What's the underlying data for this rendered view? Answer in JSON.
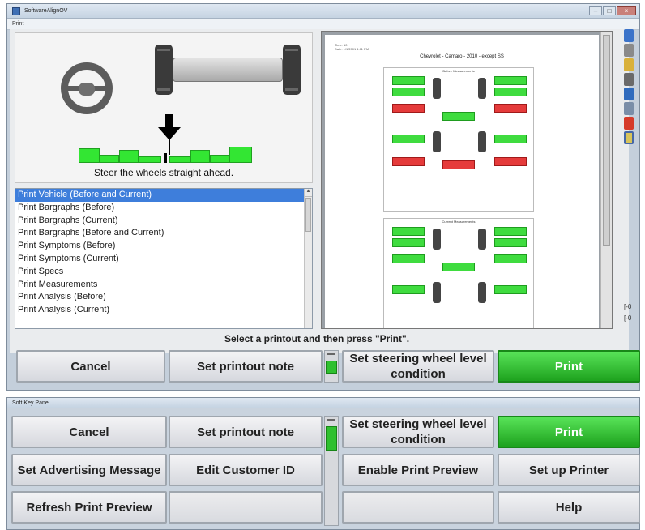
{
  "window": {
    "title": "SoftwareAlignOV"
  },
  "menu": {
    "label": "Print"
  },
  "instruction": {
    "text": "Steer the wheels straight ahead."
  },
  "printouts": {
    "items": [
      "Print Vehicle (Before and Current)",
      "Print Bargraphs (Before)",
      "Print Bargraphs (Current)",
      "Print Bargraphs (Before and Current)",
      "Print Symptoms (Before)",
      "Print Symptoms (Current)",
      "Print Specs",
      "Print Measurements",
      "Print Analysis (Before)",
      "Print Analysis (Current)"
    ],
    "selected_index": 0
  },
  "preview": {
    "header_line1": "Time:          10",
    "header_line2": "Date:      1/1/2001 1:11 PM",
    "title": "Chevrolet - Camaro - 2010 - except SS",
    "section1": "Before Measurements",
    "section2": "Current Measurements"
  },
  "hint": "Select a printout and then press \"Print\".",
  "main_keys": {
    "cancel": "Cancel",
    "set_printout_note": "Set printout note",
    "set_steering_wheel": "Set steering wheel level condition",
    "print": "Print"
  },
  "soft_key_panel": {
    "title": "Soft Key Panel",
    "row1": {
      "cancel": "Cancel",
      "set_printout_note": "Set printout note",
      "set_steering_wheel": "Set steering wheel level condition",
      "print": "Print"
    },
    "row2": {
      "set_advertising": "Set Advertising Message",
      "edit_customer": "Edit Customer ID",
      "enable_preview": "Enable Print Preview",
      "setup_printer": "Set up Printer"
    },
    "row3": {
      "refresh_preview": "Refresh Print Preview",
      "help": "Help"
    }
  },
  "colors": {
    "accent_green": "#2fc02f",
    "selection_blue": "#3e7edb",
    "bad_red": "#e53b3b"
  }
}
